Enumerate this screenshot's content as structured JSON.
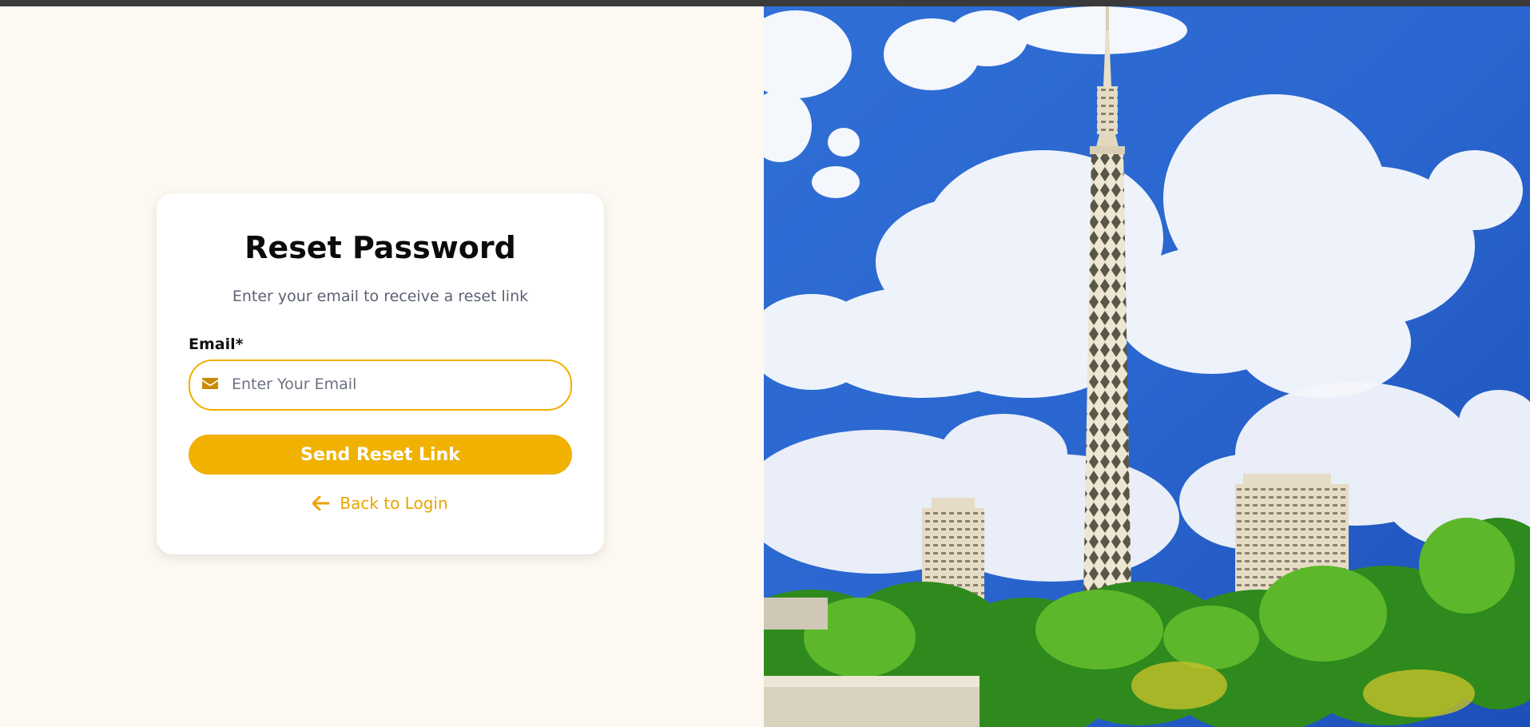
{
  "colors": {
    "accent": "#f0b100",
    "link": "#eaa300",
    "page_bg": "#fdf8f1",
    "card_bg": "#ffffff"
  },
  "reset_card": {
    "title": "Reset Password",
    "subtitle": "Enter your email to receive a reset link",
    "email_label": "Email*",
    "email_placeholder": "Enter Your Email",
    "email_value": "",
    "email_icon": "envelope-icon",
    "submit_label": "Send Reset Link",
    "back_label": "Back to Login",
    "back_icon": "arrow-left-icon"
  },
  "hero_image": {
    "description_icon": "tower-photo"
  }
}
